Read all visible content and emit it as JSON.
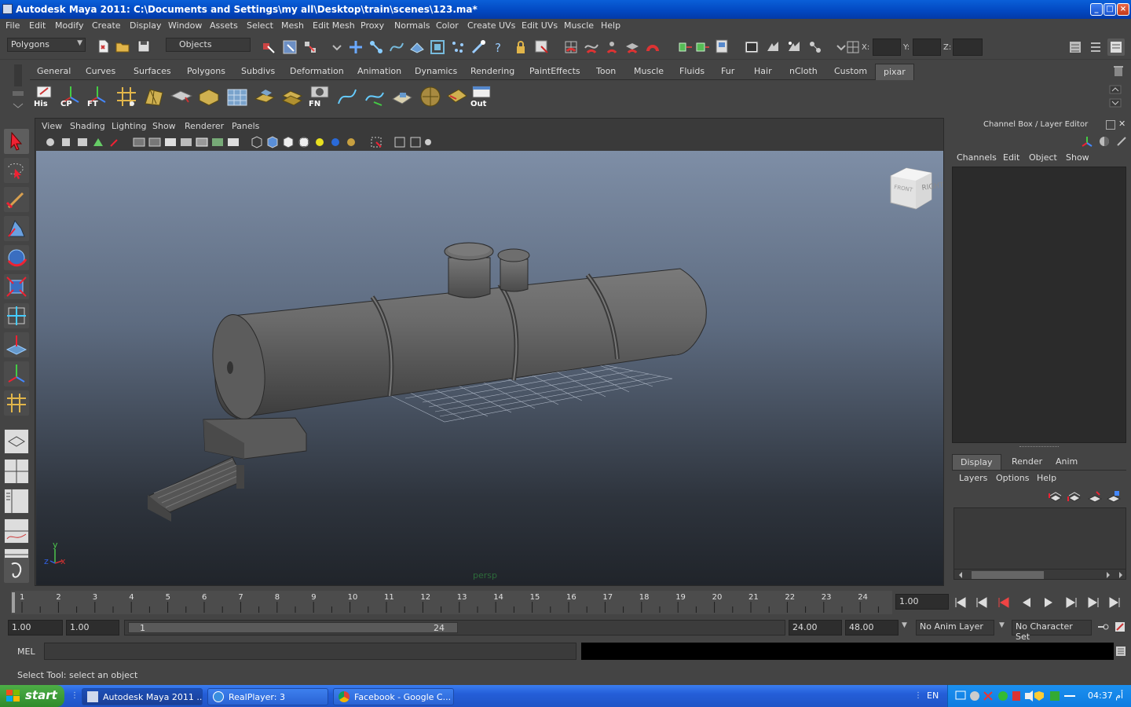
{
  "window": {
    "title": "Autodesk Maya 2011: C:\\Documents and Settings\\my all\\Desktop\\train\\scenes\\123.ma*"
  },
  "menubar": [
    "File",
    "Edit",
    "Modify",
    "Create",
    "Display",
    "Window",
    "Assets",
    "Select",
    "Mesh",
    "Edit Mesh",
    "Proxy",
    "Normals",
    "Color",
    "Create UVs",
    "Edit UVs",
    "Muscle",
    "Help"
  ],
  "statusline": {
    "mode": "Polygons",
    "selection_mask": "Objects",
    "x_label": "X:",
    "y_label": "Y:",
    "z_label": "Z:"
  },
  "shelf": {
    "tabs": [
      "General",
      "Curves",
      "Surfaces",
      "Polygons",
      "Subdivs",
      "Deformation",
      "Animation",
      "Dynamics",
      "Rendering",
      "PaintEffects",
      "Toon",
      "Muscle",
      "Fluids",
      "Fur",
      "Hair",
      "nCloth",
      "Custom",
      "pixar"
    ],
    "active_tab": "pixar",
    "icon_labels": {
      "his": "His",
      "cp": "CP",
      "ft": "FT",
      "fn": "FN",
      "out": "Out"
    }
  },
  "viewport": {
    "menus": [
      "View",
      "Shading",
      "Lighting",
      "Show",
      "Renderer",
      "Panels"
    ],
    "camera_label": "persp",
    "viewcube": {
      "front": "FRONT",
      "right": "RIGHT"
    },
    "axis": {
      "x": "x",
      "y": "y",
      "z": "z"
    }
  },
  "channelbox": {
    "title": "Channel Box / Layer Editor",
    "menus": [
      "Channels",
      "Edit",
      "Object",
      "Show"
    ]
  },
  "layereditor": {
    "tabs": [
      "Display",
      "Render",
      "Anim"
    ],
    "active_tab": "Display",
    "menus": [
      "Layers",
      "Options",
      "Help"
    ]
  },
  "timeslider": {
    "ticks": [
      "1",
      "2",
      "3",
      "4",
      "5",
      "6",
      "7",
      "8",
      "9",
      "10",
      "11",
      "12",
      "13",
      "14",
      "15",
      "16",
      "17",
      "18",
      "19",
      "20",
      "21",
      "22",
      "23",
      "24"
    ],
    "current_time": "1.00"
  },
  "rangeslider": {
    "start_time": "1.00",
    "playback_start": "1.00",
    "range_start_label": "1",
    "range_end_label": "24",
    "playback_end": "24.00",
    "end_time": "48.00",
    "anim_layer": "No Anim Layer",
    "character_set": "No Character Set"
  },
  "cmdline": {
    "label": "MEL"
  },
  "helpline": {
    "text": "Select Tool: select an object"
  },
  "taskbar": {
    "start_label": "start",
    "buttons": [
      "Autodesk Maya 2011 ...",
      "RealPlayer: 3",
      "Facebook - Google C..."
    ],
    "language": "EN",
    "clock": "04:37 أم"
  },
  "colors": {
    "maya_bg": "#444444",
    "viewport_top": "#7e8ea6",
    "viewport_bottom": "#20242a",
    "xp_blue": "#245ed8",
    "xp_green": "#2f8b2b",
    "active_tab": "#5a5a5a"
  }
}
